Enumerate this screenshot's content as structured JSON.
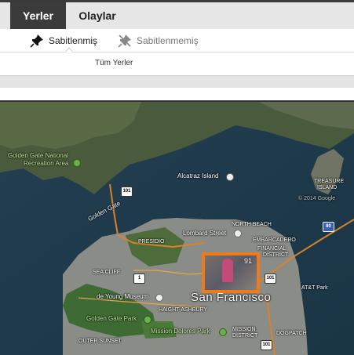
{
  "tabs": {
    "places_label": "Yerler",
    "events_label": "Olaylar"
  },
  "subtabs": {
    "pinned_label": "Sabitlenmiş",
    "unpinned_label": "Sabitlenmemiş"
  },
  "filter": {
    "all_places_label": "Tüm Yerler"
  },
  "map": {
    "labels": {
      "golden_gate_nra": "Golden Gate National",
      "golden_gate_nra_2": "Recreation Area",
      "alcatraz": "Alcatraz Island",
      "treasure_island": "TREASURE",
      "treasure_island_2": "ISLAND",
      "golden_gate": "Golden Gate",
      "presidio": "PRESIDIO",
      "lombard": "Lombard Street",
      "north_beach": "NORTH BEACH",
      "embarcadero": "EMBARCADERO",
      "financial": "FINANCIAL",
      "financial_2": "DISTRICT",
      "sea_cliff": "SEA CLIFF",
      "de_young": "de Young Museum",
      "haight": "HAIGHT-ASHBURY",
      "golden_gate_park": "Golden Gate Park",
      "mission_dolores": "Mission Dolores Park",
      "outer_sunset": "OUTER SUNSET",
      "mission": "MISSION",
      "mission_2": "DISTRICT",
      "dogpatch": "DOGPATCH",
      "ato_park": "AT&T Park",
      "san_francisco": "San Francisco",
      "copyright": "© 2014 Google"
    },
    "shields": {
      "hwy101_a": "101",
      "hwy101_b": "101",
      "hwy101_c": "101",
      "i80": "80",
      "hwy1": "1"
    },
    "photo_cluster": {
      "count": "91"
    }
  },
  "colors": {
    "active_tab_bg": "#3b3b3b",
    "cluster_border": "#ee7a1c"
  }
}
